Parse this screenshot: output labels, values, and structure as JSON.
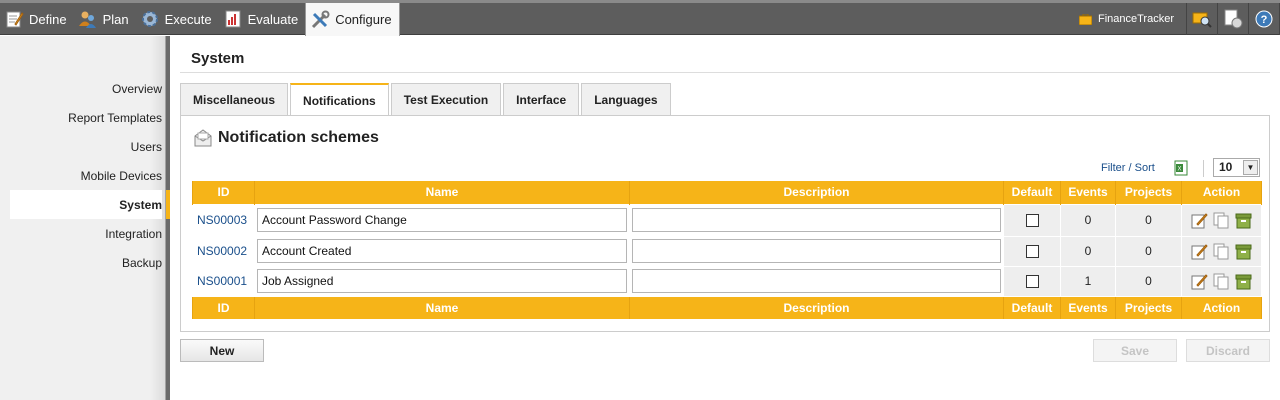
{
  "topnav": {
    "items": [
      {
        "label": "Define",
        "icon": "define-icon"
      },
      {
        "label": "Plan",
        "icon": "plan-icon"
      },
      {
        "label": "Execute",
        "icon": "execute-icon"
      },
      {
        "label": "Evaluate",
        "icon": "evaluate-icon"
      },
      {
        "label": "Configure",
        "icon": "configure-icon",
        "active": true
      }
    ],
    "project": "FinanceTracker"
  },
  "sidebar": {
    "items": [
      {
        "label": "Overview"
      },
      {
        "label": "Report Templates"
      },
      {
        "label": "Users"
      },
      {
        "label": "Mobile Devices"
      },
      {
        "label": "System",
        "active": true
      },
      {
        "label": "Integration"
      },
      {
        "label": "Backup"
      }
    ]
  },
  "page": {
    "title": "System",
    "tabs": [
      "Miscellaneous",
      "Notifications",
      "Test Execution",
      "Interface",
      "Languages"
    ],
    "active_tab": "Notifications"
  },
  "panel": {
    "title": "Notification schemes",
    "filter_label": "Filter / Sort",
    "page_size": "10"
  },
  "table": {
    "columns": [
      "ID",
      "Name",
      "Description",
      "Default",
      "Events",
      "Projects",
      "Action"
    ],
    "rows": [
      {
        "id": "NS00003",
        "name": "Account Password Change",
        "description": "",
        "default": false,
        "events": "0",
        "projects": "0"
      },
      {
        "id": "NS00002",
        "name": "Account Created",
        "description": "",
        "default": false,
        "events": "0",
        "projects": "0"
      },
      {
        "id": "NS00001",
        "name": "Job Assigned",
        "description": "",
        "default": false,
        "events": "1",
        "projects": "0"
      }
    ]
  },
  "buttons": {
    "new": "New",
    "save": "Save",
    "discard": "Discard"
  },
  "colors": {
    "accent": "#f6b418",
    "link": "#1a4f8b",
    "topbar": "#5d5d5d"
  }
}
